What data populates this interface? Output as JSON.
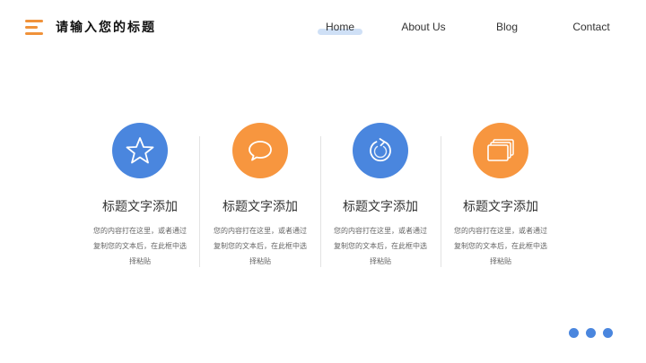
{
  "header": {
    "title": "请输入您的标题",
    "logo_icon": "menu-lines-icon",
    "nav": [
      {
        "label": "Home",
        "active": true
      },
      {
        "label": "About Us",
        "active": false
      },
      {
        "label": "Blog",
        "active": false
      },
      {
        "label": "Contact",
        "active": false
      }
    ]
  },
  "colors": {
    "blue": "#4a86de",
    "orange": "#f7963f",
    "logo_orange": "#f0923a",
    "nav_highlight": "#cfe0f6"
  },
  "features": [
    {
      "icon": "star-icon",
      "color": "#4a86de",
      "title": "标题文字添加",
      "desc": "您的内容打在这里，或者通过复制您的文本后，在此框中选择粘贴"
    },
    {
      "icon": "chat-bubble-icon",
      "color": "#f7963f",
      "title": "标题文字添加",
      "desc": "您的内容打在这里，或者通过复制您的文本后，在此框中选择粘贴"
    },
    {
      "icon": "refresh-icon",
      "color": "#4a86de",
      "title": "标题文字添加",
      "desc": "您的内容打在这里，或者通过复制您的文本后，在此框中选择粘贴"
    },
    {
      "icon": "stacked-cards-icon",
      "color": "#f7963f",
      "title": "标题文字添加",
      "desc": "您的内容打在这里，或者通过复制您的文本后，在此框中选择粘贴"
    }
  ],
  "pager": {
    "dot_count": 3,
    "color": "#4a86de"
  }
}
